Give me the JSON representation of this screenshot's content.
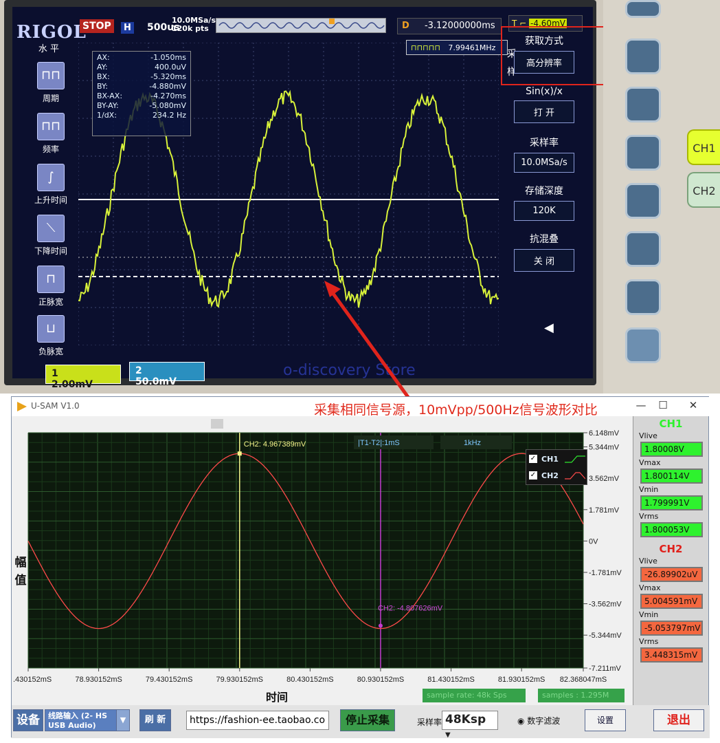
{
  "oscilloscope": {
    "brand": "RIGOL",
    "run_state": "STOP",
    "timebase_marker": "H",
    "timebase": "500us",
    "sample_rate": "10.0MSa/s",
    "memory_points": "120k pts",
    "delay_label": "D",
    "delay_value": "-3.12000000ms",
    "trigger_level": "-4.60mV",
    "freq_counter": "7.99461MHz",
    "left_menu_title": "水 平",
    "left_menu": [
      {
        "label": "周期",
        "icon": "period-icon"
      },
      {
        "label": "频率",
        "icon": "frequency-icon"
      },
      {
        "label": "上升时间",
        "icon": "rise-time-icon"
      },
      {
        "label": "下降时间",
        "icon": "fall-time-icon"
      },
      {
        "label": "正脉宽",
        "icon": "positive-pulse-icon"
      },
      {
        "label": "负脉宽",
        "icon": "negative-pulse-icon"
      }
    ],
    "measurements": [
      {
        "name": "AX:",
        "value": "-1.050ms"
      },
      {
        "name": "AY:",
        "value": "400.0uV"
      },
      {
        "name": "BX:",
        "value": "-5.320ms"
      },
      {
        "name": "BY:",
        "value": "-4.880mV"
      },
      {
        "name": "BX-AX:",
        "value": "-4.270ms"
      },
      {
        "name": "BY-AY:",
        "value": "-5.080mV"
      },
      {
        "name": "1/dX:",
        "value": "234.2 Hz"
      }
    ],
    "right_menu": {
      "side_label": "采\n样",
      "acq_mode_title": "获取方式",
      "acq_mode_value": "高分辨率",
      "sinx_title": "Sin(x)/x",
      "sinx_value": "打 开",
      "srate_title": "采样率",
      "srate_value": "10.0MSa/s",
      "mem_title": "存储深度",
      "mem_value": "120K",
      "aa_title": "抗混叠",
      "aa_value": "关 闭"
    },
    "ch1_num": "1",
    "ch1_scale": "2.00mV",
    "ch2_num": "2",
    "ch2_scale": "50.0mV",
    "watermark": "o-discovery Store",
    "hw_ch1": "CH1",
    "hw_ch2": "CH2",
    "colors": {
      "ch1_trace": "#d8f23a",
      "screen_bg": "#0b0f2e",
      "highlight": "#e0241c"
    }
  },
  "software": {
    "title": "U-SAM V1.0",
    "annotation": "采集相同信号源，10mVpp/500Hz信号波形对比",
    "window_controls": [
      "—",
      "☐",
      "✕"
    ],
    "amplitude_label": "幅\n值",
    "time_label": "时间",
    "cursor1_readout": "CH2:  4.967389mV",
    "cursor2_readout": "CH2:  -4.807626mV",
    "cursor_delta": "|T1-T2|:1mS",
    "cursor_freq": "1kHz",
    "legend": [
      {
        "name": "CH1",
        "checked": "✓",
        "color": "#2fe82f"
      },
      {
        "name": "CH2",
        "checked": "✓",
        "color": "#ff4a4a"
      }
    ],
    "y_ticks": [
      "6.148mV",
      "5.344mV",
      "3.562mV",
      "1.781mV",
      "0V",
      "-1.781mV",
      "-3.562mV",
      "-5.344mV",
      "-7.211mV"
    ],
    "x_ticks": [
      ".430152mS",
      "78.930152mS",
      "79.430152mS",
      "79.930152mS",
      "80.430152mS",
      "80.930152mS",
      "81.430152mS",
      "81.930152mS",
      "82.368047mS"
    ],
    "status_sample_rate": "sample rate: 48k Sps",
    "status_samples": "samples : 1.295M",
    "ch1_stats": {
      "header": "CH1",
      "vlive_label": "Vlive",
      "vlive": "1.80008V",
      "vmax_label": "Vmax",
      "vmax": "1.800114V",
      "vmin_label": "Vmin",
      "vmin": "1.799991V",
      "vrms_label": "Vrms",
      "vrms": "1.800053V"
    },
    "ch2_stats": {
      "header": "CH2",
      "vlive_label": "Vlive",
      "vlive": "-26.89902uV",
      "vmax_label": "Vmax",
      "vmax": "5.004591mV",
      "vmin_label": "Vmin",
      "vmin": "-5.053797mV",
      "vrms_label": "Vrms",
      "vrms": "3.448315mV"
    },
    "bottom": {
      "device_label": "设备",
      "device_select": "线路输入 (2- HS\nUSB Audio)",
      "refresh": "刷 新",
      "url": "https://fashion-ee.taobao.com",
      "stop_capture": "停止采集",
      "srate_label": "采样率",
      "srate_value": "48Ksp",
      "digital_filter": "数字滤波",
      "settings": "设置",
      "exit": "退出"
    }
  },
  "chart_data": {
    "type": "line",
    "title": "",
    "xlabel": "时间",
    "ylabel": "幅值",
    "xlim": [
      78.430152,
      82.368047
    ],
    "ylim": [
      -7.211,
      6.148
    ],
    "series": [
      {
        "name": "CH2",
        "frequency_hz": 500,
        "amplitude_mv": 4.967389,
        "peak_x_ms": 79.930152,
        "trough_x_ms": 80.930152
      }
    ],
    "cursors": [
      {
        "x_ms": 79.930152,
        "y_mv": 4.967389
      },
      {
        "x_ms": 80.930152,
        "y_mv": -4.807626
      }
    ],
    "grid": true,
    "legend": "top-right"
  }
}
